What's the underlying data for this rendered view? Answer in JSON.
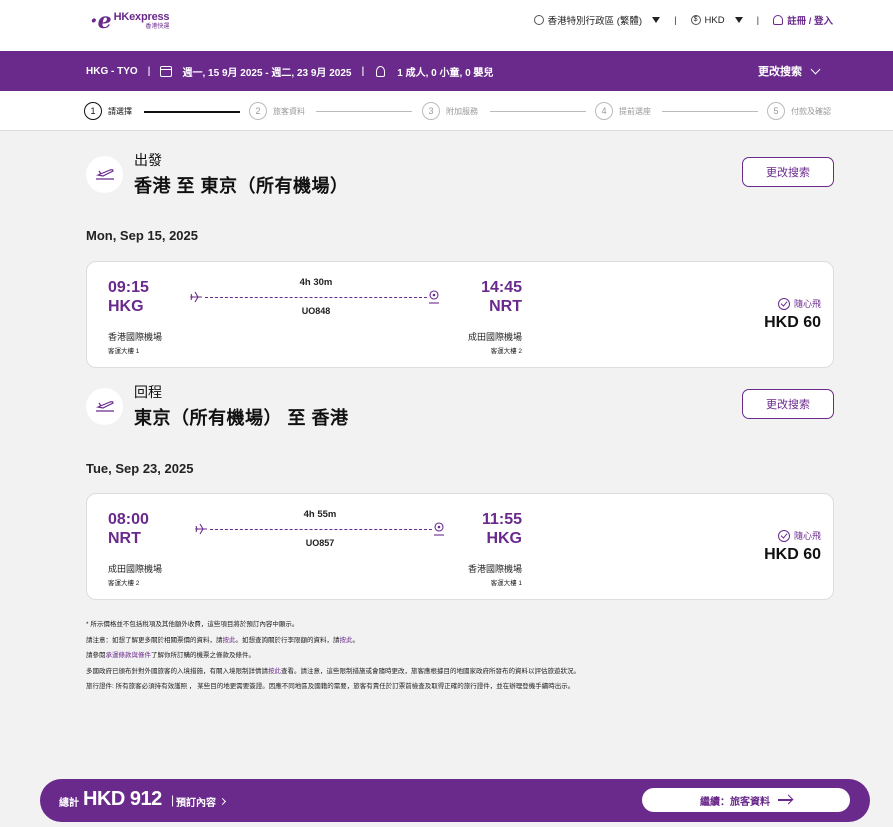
{
  "header": {
    "logo_brand": "HKexpress",
    "logo_sub": "香港快運",
    "region": "香港特別行政區 (繁體)",
    "currency": "HKD",
    "login": "註冊 / 登入"
  },
  "search": {
    "route": "HKG - TYO",
    "dates": "週一, 15 9月 2025 - 週二, 23 9月 2025",
    "passengers": "1 成人, 0 小童, 0 嬰兒",
    "modify": "更改搜索"
  },
  "steps": [
    {
      "num": "1",
      "label": "請選擇"
    },
    {
      "num": "2",
      "label": "旅客資料"
    },
    {
      "num": "3",
      "label": "附加服務"
    },
    {
      "num": "4",
      "label": "提前選座"
    },
    {
      "num": "5",
      "label": "付款及確認"
    }
  ],
  "outbound": {
    "type": "出發",
    "route": "香港 至 東京（所有機場）",
    "modify": "更改搜索",
    "date": "Mon, Sep 15, 2025",
    "dep_time": "09:15",
    "dep_code": "HKG",
    "dep_airport": "香港國際機場",
    "dep_terminal": "客運大樓 1",
    "duration": "4h 30m",
    "flight_no": "UO848",
    "arr_time": "14:45",
    "arr_code": "NRT",
    "arr_airport": "成田國際機場",
    "arr_terminal": "客運大樓 2",
    "fare_type": "隨心飛",
    "price": "HKD 60"
  },
  "inbound": {
    "type": "回程",
    "route": "東京（所有機場） 至 香港",
    "modify": "更改搜索",
    "date": "Tue, Sep 23, 2025",
    "dep_time": "08:00",
    "dep_code": "NRT",
    "dep_airport": "成田國際機場",
    "dep_terminal": "客運大樓 2",
    "duration": "4h 55m",
    "flight_no": "UO857",
    "arr_time": "11:55",
    "arr_code": "HKG",
    "arr_airport": "香港國際機場",
    "arr_terminal": "客運大樓 1",
    "fare_type": "隨心飛",
    "price": "HKD 60"
  },
  "notes": {
    "n1": "* 所示價格並不包括稅項及其他額外收費，這些項目將於預訂內容中顯示。",
    "n2a": "請注意：如想了解更多關於相關票價的資料，請",
    "n2_link1": "按此",
    "n2b": "。如想查詢關於行李限額的資料，請",
    "n2_link2": "按此",
    "n2c": "。",
    "n3a": "請參閱",
    "n3_link": "承運條款與條件",
    "n3b": "了解你所訂購的機票之條款及條件。",
    "n4a": " 多國政府已頒布針對外國旅客的入境措施，有關入境限制詳情請",
    "n4_link": "按此",
    "n4b": "查看。請注意，這些限制措施或會隨時更改，旅客應根據目的地國家政府所發布的資料以評估旅遊狀況。",
    "n5": "旅行證件: 所有旅客必須持有效護照 ， 某些目的地更需要簽證。因應不同地區及國籍的需要，旅客有責任於訂票前檢查及取得正確的旅行證件，並在辦理登機手續時出示。"
  },
  "footer": {
    "total_label": "總計",
    "total_value": "HKD 912",
    "booking_link": "預訂內容",
    "continue": "繼續：旅客資料"
  },
  "colors": {
    "brand": "#6a2a8c",
    "background": "#f2f2f2"
  }
}
